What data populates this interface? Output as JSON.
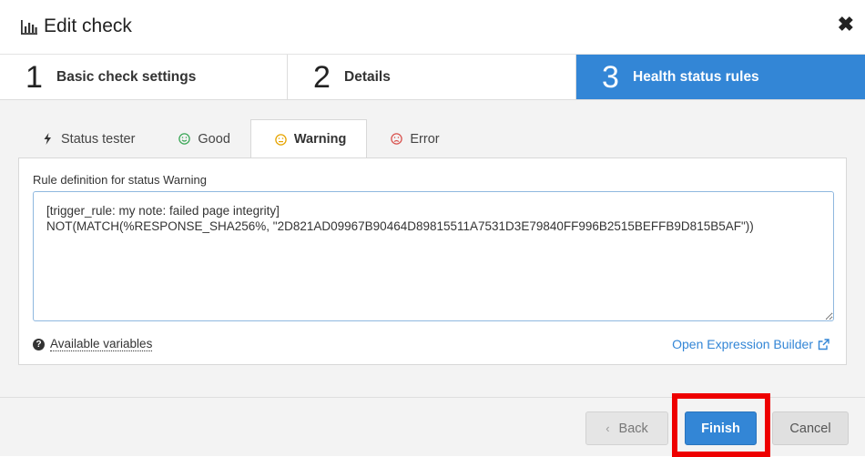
{
  "dialog": {
    "title": "Edit check",
    "title_icon": "bar-chart-icon",
    "close_label": "✖"
  },
  "steps": [
    {
      "number": "1",
      "label": "Basic check settings",
      "active": false
    },
    {
      "number": "2",
      "label": "Details",
      "active": false
    },
    {
      "number": "3",
      "label": "Health status rules",
      "active": true
    }
  ],
  "tabs": [
    {
      "label": "Status tester",
      "icon": "bolt-icon",
      "active": false
    },
    {
      "label": "Good",
      "icon": "smile-icon",
      "icon_color": "#3aa757",
      "active": false
    },
    {
      "label": "Warning",
      "icon": "neutral-face-icon",
      "icon_color": "#e6a400",
      "active": true
    },
    {
      "label": "Error",
      "icon": "frown-icon",
      "icon_color": "#d9534f",
      "active": false
    }
  ],
  "rule": {
    "label": "Rule definition for status Warning",
    "value": "[trigger_rule: my note: failed page integrity]\nNOT(MATCH(%RESPONSE_SHA256%, \"2D821AD09967B90464D89815511A7531D3E79840FF996B2515BEFFB9D815B5AF\"))"
  },
  "links": {
    "available_variables": "Available variables",
    "open_builder": "Open Expression Builder"
  },
  "footer": {
    "back_label": "Back",
    "finish_label": "Finish",
    "cancel_label": "Cancel"
  },
  "colors": {
    "accent": "#3386d6",
    "highlight": "#ee0000"
  }
}
